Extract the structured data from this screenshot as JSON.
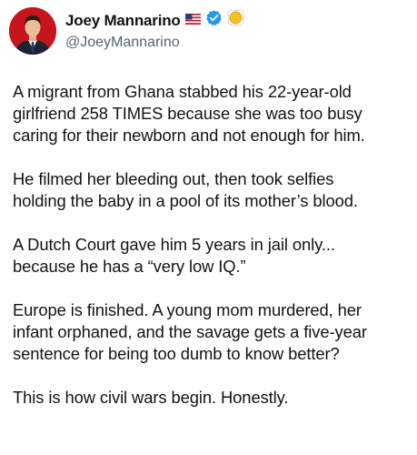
{
  "author": {
    "display_name": "Joey Mannarino",
    "handle": "@JoeyMannarino",
    "avatar_icon": "profile-photo",
    "flag_icon": "us-flag-icon",
    "verified_icon": "verified-badge-icon",
    "affiliation_icon": "gold-affiliation-badge-icon",
    "colors": {
      "verified": "#1d9bf0",
      "gold": "#f4c01e",
      "avatar_bg": "#c8141c"
    }
  },
  "post": {
    "paragraphs": [
      "A migrant from Ghana stabbed his 22-year-old\ngirlfriend 258 TIMES because she was too busy\ncaring for their newborn and not enough for him.",
      "He filmed her bleeding out, then took selfies\nholding the baby in a pool of its mother’s blood.",
      "A Dutch Court gave him 5 years in jail only...\nbecause he has a “very low IQ.”",
      "Europe is finished. A young mom murdered, her\ninfant orphaned, and the savage gets a five-year\nsentence for being too dumb to know better?",
      "This is how civil wars begin. Honestly."
    ]
  }
}
